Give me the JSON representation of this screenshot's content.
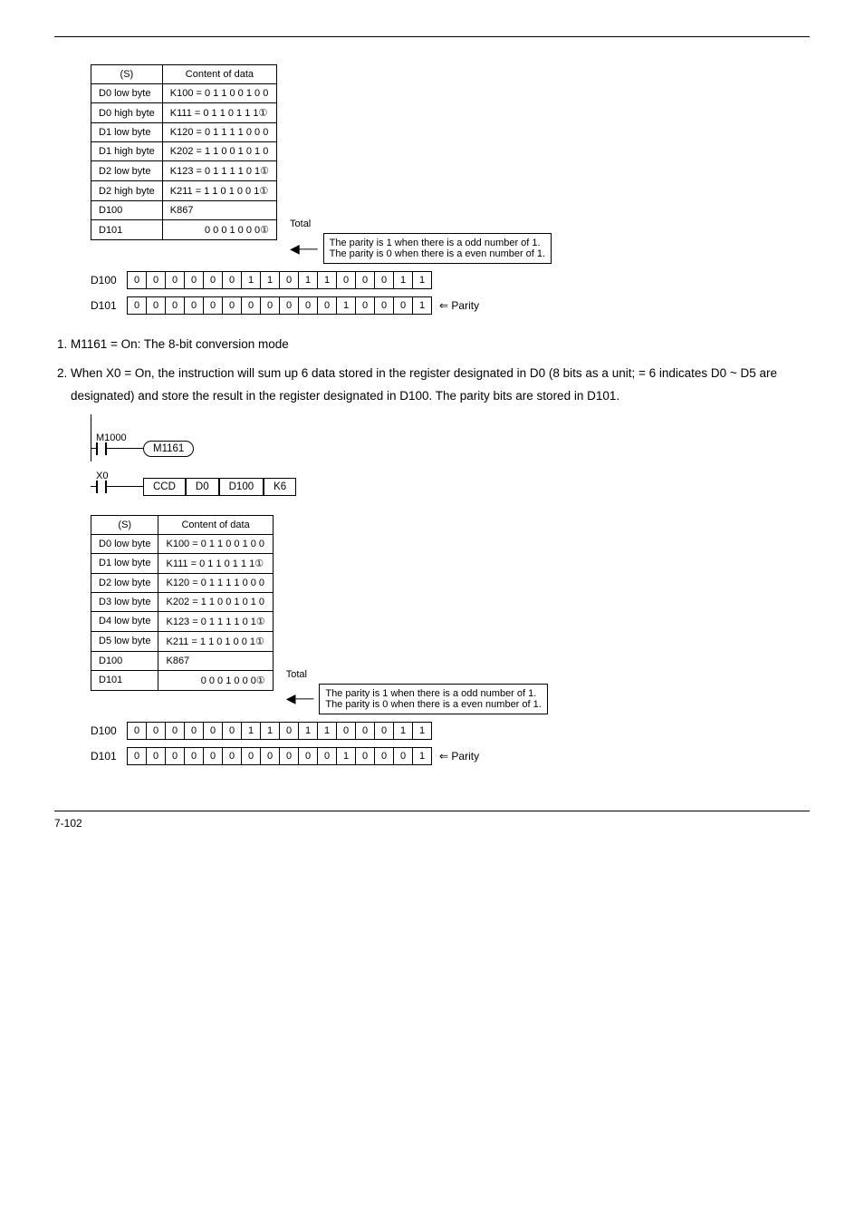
{
  "table1": {
    "header": [
      "(S)",
      "Content of data"
    ],
    "rows": [
      [
        "D0 low byte",
        "K100 = 0 1 1 0 0 1 0 0"
      ],
      [
        "D0 high byte",
        "K111 = 0 1 1 0 1 1 1①"
      ],
      [
        "D1 low byte",
        "K120 = 0 1 1 1 1 0 0 0"
      ],
      [
        "D1 high byte",
        "K202 = 1 1 0 0 1 0 1 0"
      ],
      [
        "D2 low byte",
        "K123 = 0 1 1 1 1 0 1①"
      ],
      [
        "D2 high byte",
        "K211 = 1 1 0 1 0 0 1①"
      ],
      [
        "D100",
        "K867"
      ],
      [
        "D101",
        "0 0 0 1 0 0 0①"
      ]
    ],
    "total": "Total",
    "parity_box": "The parity is 1 when there is a odd number of 1.\nThe parity is 0 when there is a even number of 1."
  },
  "bits1": {
    "d100": {
      "label": "D100",
      "cells": [
        "0",
        "0",
        "0",
        "0",
        "0",
        "0",
        "1",
        "1",
        "0",
        "1",
        "1",
        "0",
        "0",
        "0",
        "1",
        "1"
      ]
    },
    "d101": {
      "label": "D101",
      "cells": [
        "0",
        "0",
        "0",
        "0",
        "0",
        "0",
        "0",
        "0",
        "0",
        "0",
        "0",
        "1",
        "0",
        "0",
        "0",
        "1"
      ],
      "suffix": "⇐ Parity"
    }
  },
  "list": {
    "item1": "M1161 = On: The 8-bit conversion mode",
    "item2": "When X0 = On, the instruction will sum up 6 data stored in the register designated in D0 (8 bits as a unit;     = 6 indicates D0 ~ D5 are designated) and store the result in the register designated in D100. The parity bits are stored in D101."
  },
  "ladder": {
    "m1000": "M1000",
    "m1161": "M1161",
    "x0": "X0",
    "ccd": "CCD",
    "d0": "D0",
    "d100": "D100",
    "k6": "K6"
  },
  "table2": {
    "header": [
      "(S)",
      "Content of data"
    ],
    "rows": [
      [
        "D0 low byte",
        "K100 = 0 1 1 0 0 1 0 0"
      ],
      [
        "D1 low byte",
        "K111 = 0 1 1 0 1 1 1①"
      ],
      [
        "D2 low byte",
        "K120 = 0 1 1 1 1 0 0 0"
      ],
      [
        "D3 low byte",
        "K202 = 1 1 0 0 1 0 1 0"
      ],
      [
        "D4 low byte",
        "K123 = 0 1 1 1 1 0 1①"
      ],
      [
        "D5 low byte",
        "K211 = 1 1 0 1 0 0 1①"
      ],
      [
        "D100",
        "K867"
      ],
      [
        "D101",
        "0 0 0 1 0 0 0①"
      ]
    ],
    "total": "Total",
    "parity_box": "The parity is 1 when there is a odd number of 1.\nThe parity is 0 when there is a even number of 1."
  },
  "bits2": {
    "d100": {
      "label": "D100",
      "cells": [
        "0",
        "0",
        "0",
        "0",
        "0",
        "0",
        "1",
        "1",
        "0",
        "1",
        "1",
        "0",
        "0",
        "0",
        "1",
        "1"
      ]
    },
    "d101": {
      "label": "D101",
      "cells": [
        "0",
        "0",
        "0",
        "0",
        "0",
        "0",
        "0",
        "0",
        "0",
        "0",
        "0",
        "1",
        "0",
        "0",
        "0",
        "1"
      ],
      "suffix": "⇐ Parity"
    }
  },
  "footer": "7-102"
}
